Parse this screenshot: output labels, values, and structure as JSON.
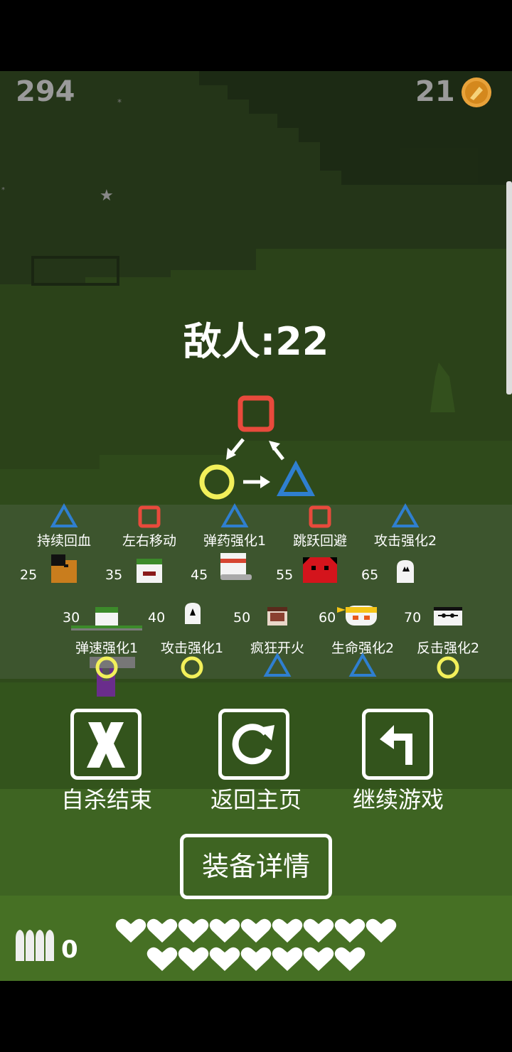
{
  "hud": {
    "score": "294",
    "coins": "21"
  },
  "enemy": {
    "label": "敌人:22"
  },
  "row1_skills": [
    {
      "label": "持续回血",
      "shape": "triangle"
    },
    {
      "label": "左右移动",
      "shape": "square"
    },
    {
      "label": "弹药强化1",
      "shape": "triangle"
    },
    {
      "label": "跳跃回避",
      "shape": "square"
    },
    {
      "label": "攻击强化2",
      "shape": "triangle"
    }
  ],
  "row1_levels": [
    "25",
    "35",
    "45",
    "55",
    "65"
  ],
  "row2_levels": [
    "30",
    "40",
    "50",
    "60",
    "70"
  ],
  "row2_skills": [
    {
      "label": "弹速强化1",
      "shape": "circle"
    },
    {
      "label": "攻击强化1",
      "shape": "circle"
    },
    {
      "label": "疯狂开火",
      "shape": "triangle"
    },
    {
      "label": "生命强化2",
      "shape": "triangle"
    },
    {
      "label": "反击强化2",
      "shape": "circle"
    }
  ],
  "buttons": {
    "suicide": "自杀结束",
    "home": "返回主页",
    "continue": "继续游戏",
    "equipment": "装备详情"
  },
  "ammo": {
    "count": "0"
  },
  "hearts": {
    "row1": 9,
    "row2": 7
  },
  "colors": {
    "square": "#e84a3c",
    "circle": "#f2f05a",
    "triangle": "#2f7fd0"
  }
}
